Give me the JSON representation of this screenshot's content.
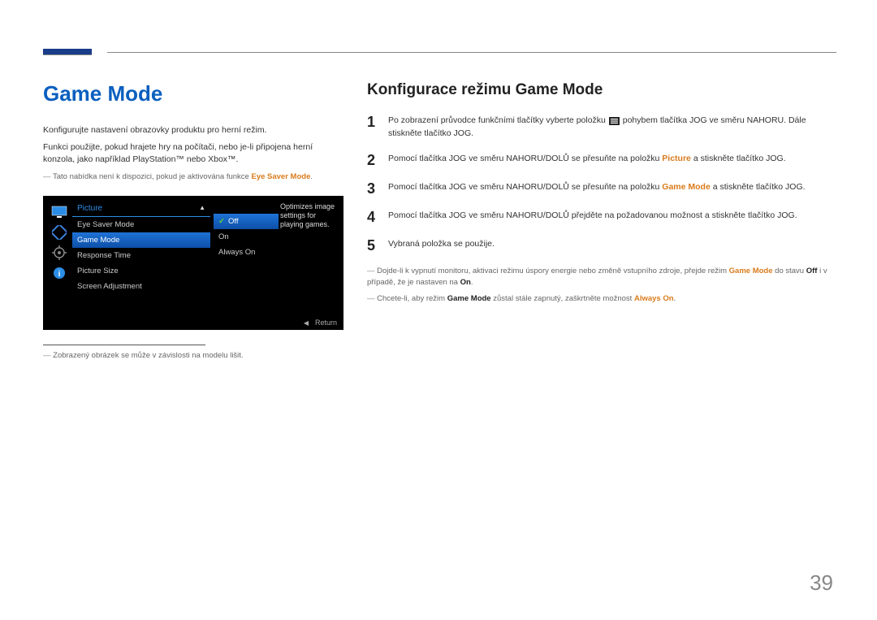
{
  "page_number": "39",
  "left": {
    "title": "Game Mode",
    "p1": "Konfigurujte nastavení obrazovky produktu pro herní režim.",
    "p2": "Funkci použijte, pokud hrajete hry na počítači, nebo je-li připojena herní konzola, jako například PlayStation™ nebo Xbox™.",
    "note1_pre": "Tato nabídka není k dispozici, pokud je aktivována funkce ",
    "note1_kw": "Eye Saver Mode",
    "note1_post": ".",
    "footnote": "Zobrazený obrázek se může v závislosti na modelu lišit."
  },
  "osd": {
    "header": "Picture",
    "rows": [
      "Eye Saver Mode",
      "Game Mode",
      "Response Time",
      "Picture Size",
      "Screen Adjustment"
    ],
    "active_index": 1,
    "sub": [
      "Off",
      "On",
      "Always On"
    ],
    "sub_selected": 0,
    "help": "Optimizes image settings for playing games.",
    "return": "Return"
  },
  "right": {
    "subtitle": "Konfigurace režimu Game Mode",
    "steps": [
      {
        "n": "1",
        "pre": "Po zobrazení průvodce funkčními tlačítky vyberte položku ",
        "post": " pohybem tlačítka JOG ve směru NAHORU. Dále stiskněte tlačítko JOG."
      },
      {
        "n": "2",
        "pre": "Pomocí tlačítka JOG ve směru NAHORU/DOLŮ se přesuňte na položku ",
        "kw": "Picture",
        "post": " a stiskněte tlačítko JOG."
      },
      {
        "n": "3",
        "pre": "Pomocí tlačítka JOG ve směru NAHORU/DOLŮ se přesuňte na položku ",
        "kw": "Game Mode",
        "post": " a stiskněte tlačítko JOG."
      },
      {
        "n": "4",
        "text": "Pomocí tlačítka JOG ve směru NAHORU/DOLŮ přejděte na požadovanou možnost a stiskněte tlačítko JOG."
      },
      {
        "n": "5",
        "text": "Vybraná položka se použije."
      }
    ],
    "note2": {
      "pre": "Dojde-li k vypnutí monitoru, aktivaci režimu úspory energie nebo změně vstupního zdroje, přejde režim ",
      "kw1": "Game Mode",
      "mid": " do stavu ",
      "kw2": "Off",
      "mid2": " i v případě, že je nastaven na ",
      "kw3": "On",
      "post": "."
    },
    "note3": {
      "pre": "Chcete-li, aby režim ",
      "kw1": "Game Mode",
      "mid": " zůstal stále zapnutý, zaškrtněte možnost ",
      "kw2": "Always On",
      "post": "."
    }
  }
}
